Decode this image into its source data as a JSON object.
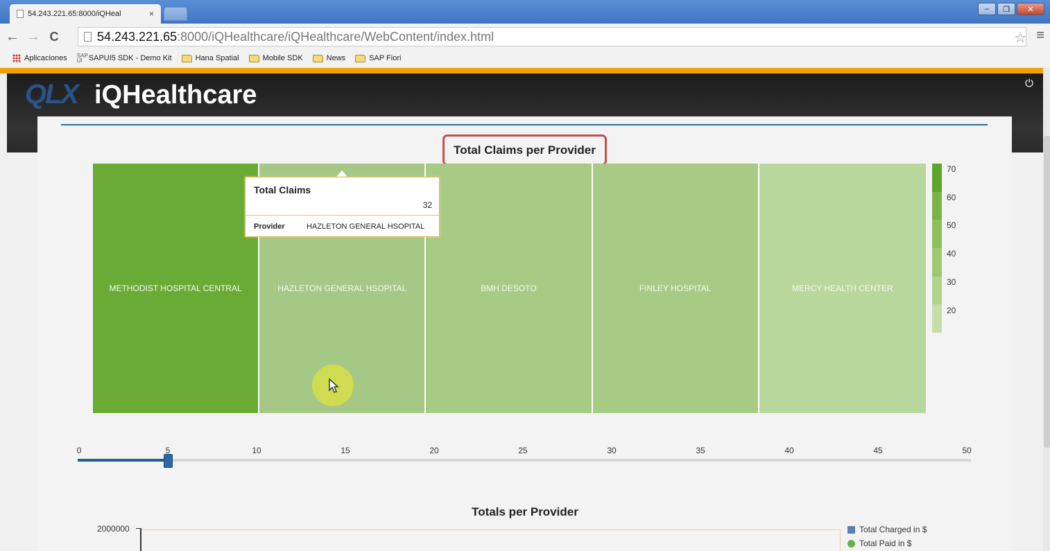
{
  "browser": {
    "tab_title": "54.243.221.65:8000/iQHeal",
    "tab_close": "×",
    "url_host": "54.243.221.65",
    "url_path": ":8000/iQHealthcare/iQHealthcare/WebContent/index.html",
    "bookmarks": [
      {
        "label": "Aplicaciones",
        "icon": "apps-icon"
      },
      {
        "label": "SAPUI5 SDK - Demo Kit",
        "icon": "sapui5-icon"
      },
      {
        "label": "Hana Spatial",
        "icon": "folder-icon"
      },
      {
        "label": "Mobile SDK",
        "icon": "folder-icon"
      },
      {
        "label": "News",
        "icon": "folder-icon"
      },
      {
        "label": "SAP Fiori",
        "icon": "folder-icon"
      }
    ]
  },
  "app": {
    "logo_text": "QLX",
    "title": "iQHealthcare"
  },
  "chart_data": [
    {
      "type": "treemap",
      "title": "Total Claims per Provider",
      "categories": [
        "METHODIST HOSPITAL CENTRAL",
        "HAZLETON GENERAL HSOPITAL",
        "BMH DESOTO",
        "FINLEY HOSPITAL",
        "MERCY HEALTH CENTER"
      ],
      "colors": [
        "#6aab36",
        "#a5c886",
        "#a7cb85",
        "#a7cb85",
        "#b8d79c"
      ],
      "legend": {
        "labels": [
          "70",
          "60",
          "50",
          "40",
          "30",
          "20"
        ],
        "colors": [
          "#5fa52b",
          "#79b546",
          "#8dc05b",
          "#9ec973",
          "#b1d48c",
          "#c4dfa7"
        ]
      },
      "tooltip": {
        "title": "Total Claims",
        "value": "32",
        "key": "Provider",
        "key_value": "HAZLETON GENERAL HSOPITAL"
      }
    },
    {
      "type": "bar",
      "title": "Totals per Provider",
      "y_tick_labels": [
        "2000000"
      ],
      "series": [
        {
          "name": "Total Charged in $",
          "color": "#5b7fb0"
        },
        {
          "name": "Total Paid in $",
          "color": "#6ab04c"
        }
      ]
    }
  ],
  "slider": {
    "min": 0,
    "max": 50,
    "value": 5,
    "ticks": [
      "0",
      "5",
      "10",
      "15",
      "20",
      "25",
      "30",
      "35",
      "40",
      "45",
      "50"
    ]
  }
}
